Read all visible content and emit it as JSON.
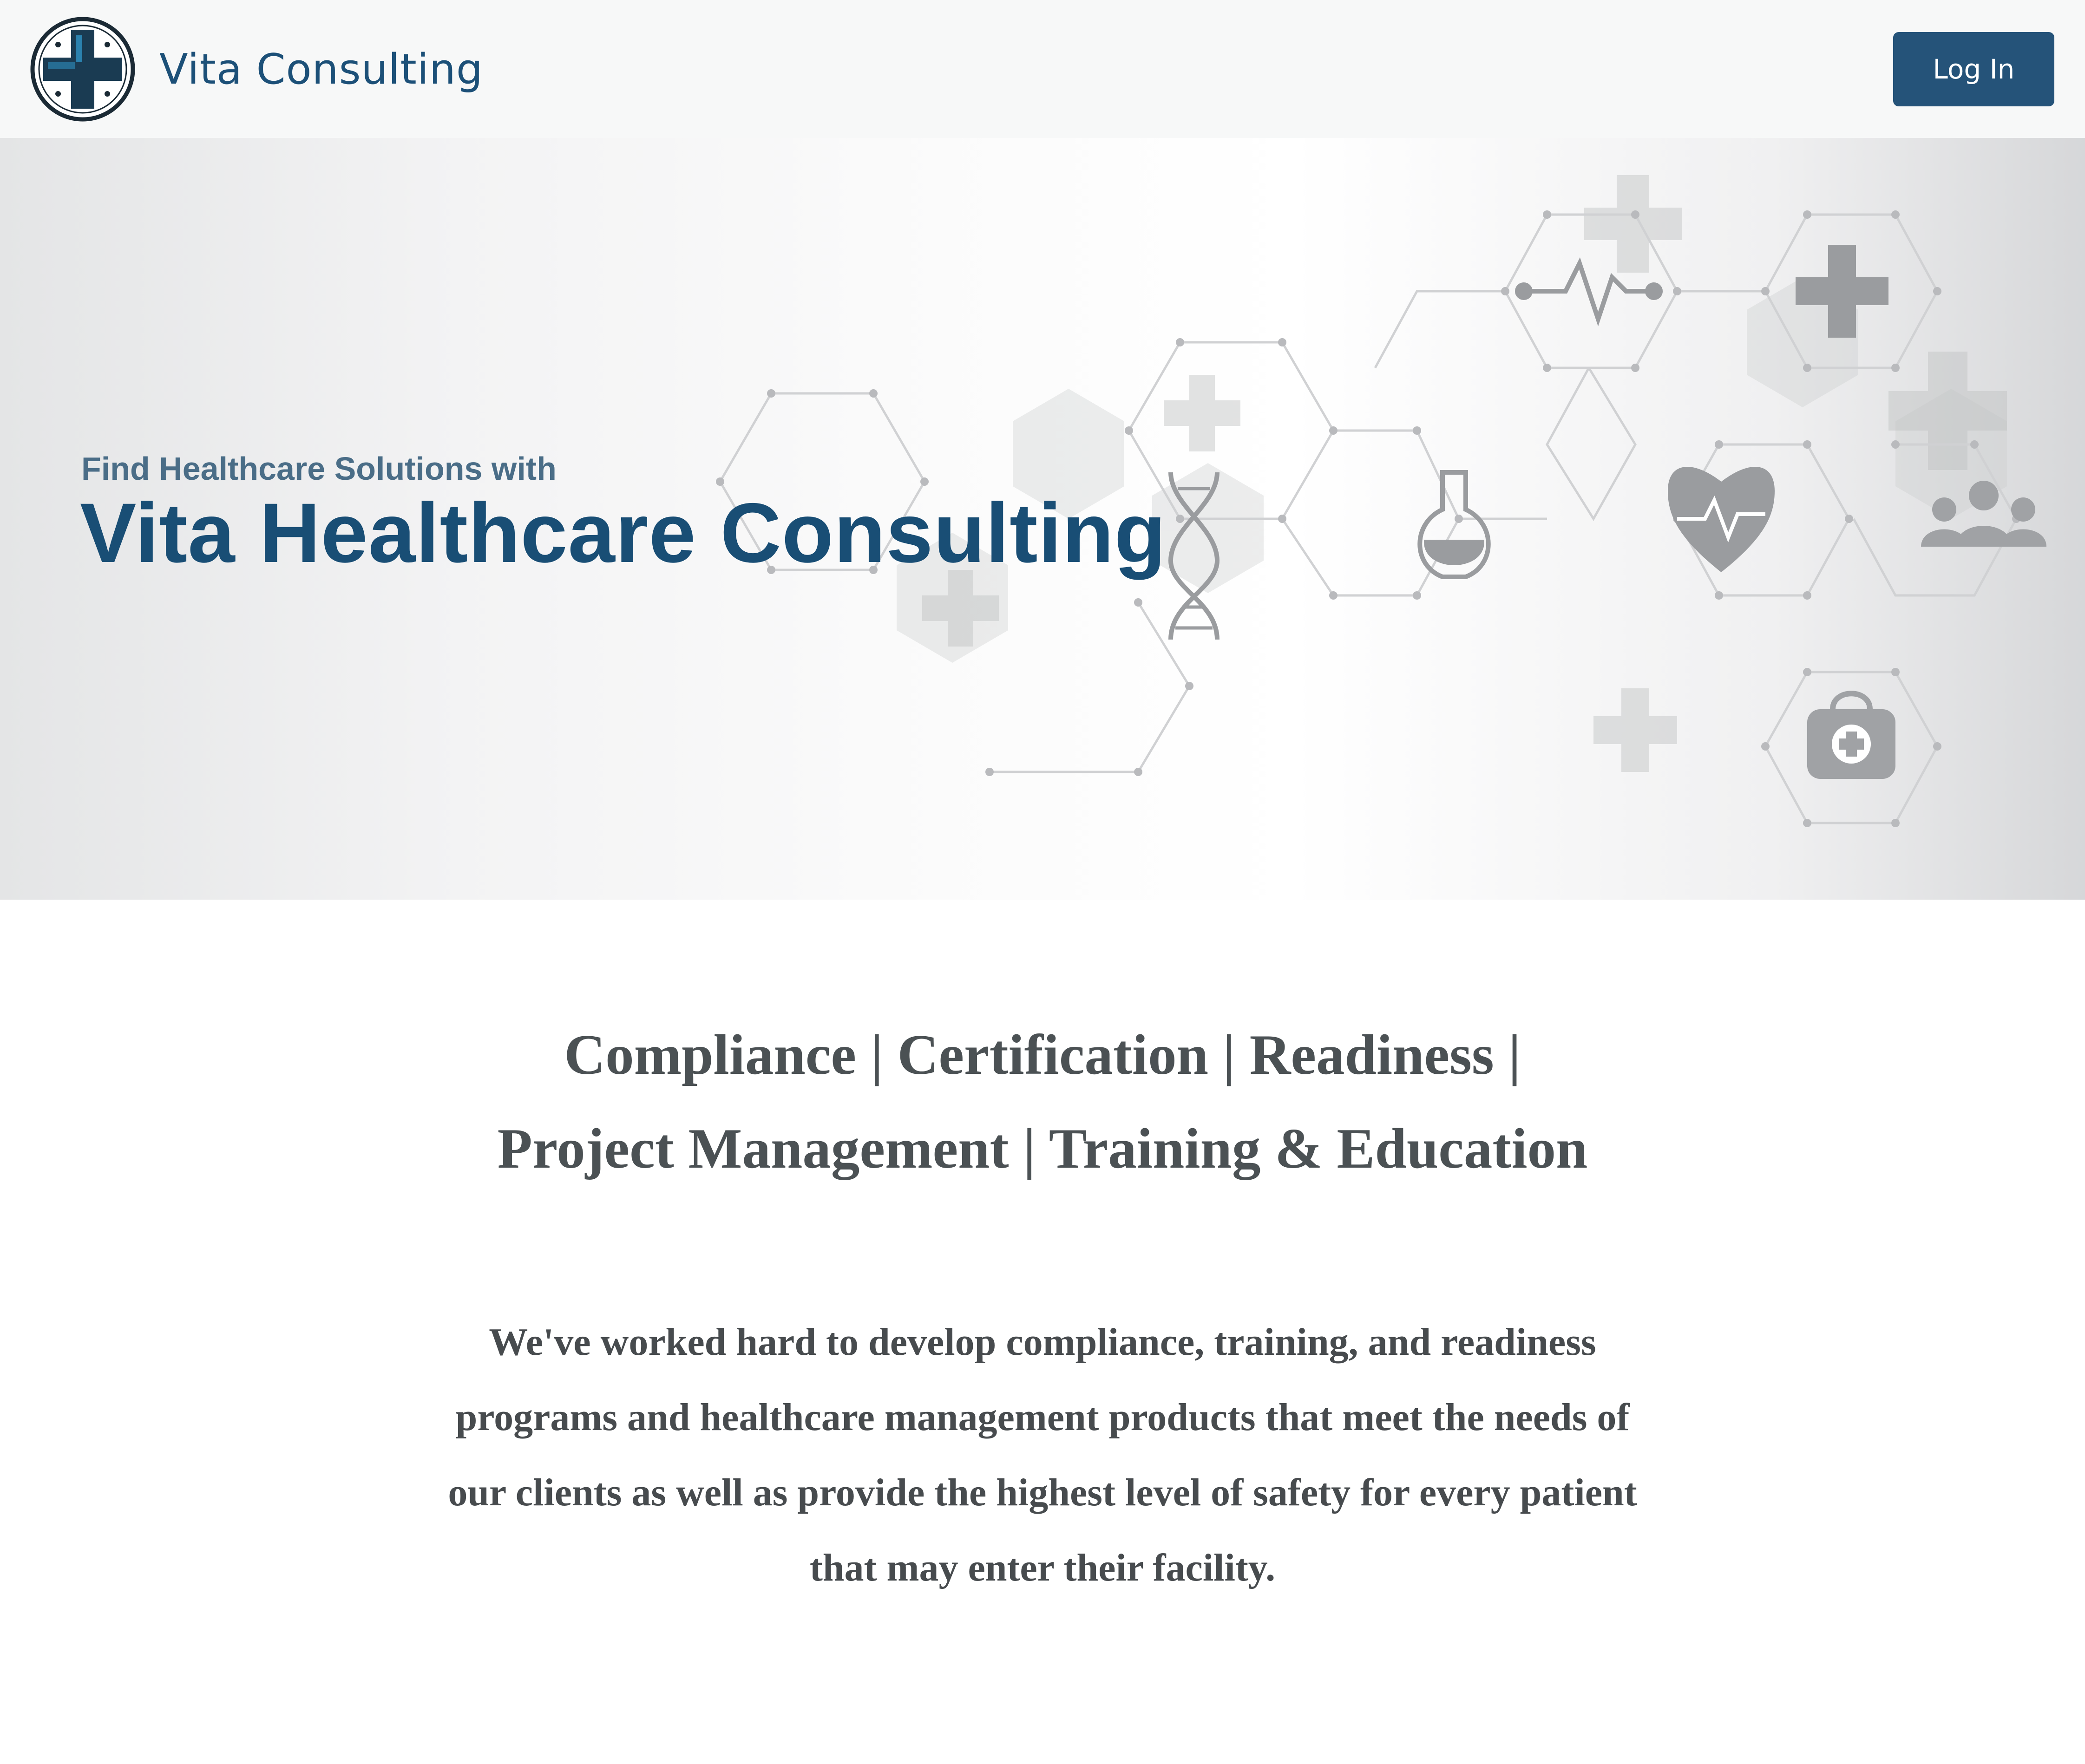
{
  "header": {
    "brand_name": "Vita Consulting",
    "logo_icon": "medical-cross-icon",
    "login_label": "Log In",
    "colors": {
      "brand": "#1c5078",
      "button": "#255379",
      "background": "#f7f8f8"
    }
  },
  "hero": {
    "tagline": "Find Healthcare Solutions with",
    "title": "Vita Healthcare Consulting",
    "icons": [
      "dna-icon",
      "heartbeat-line-icon",
      "cross-icon",
      "flask-icon",
      "heart-pulse-icon",
      "medical-team-icon",
      "first-aid-kit-icon"
    ],
    "colors": {
      "title": "#194e75",
      "tagline": "#4a6d87",
      "icon": "#9a9c9f"
    }
  },
  "services": {
    "line1": "Compliance | Certification | Readiness |",
    "line2": "Project Management | Training & Education"
  },
  "intro": {
    "text": "We've worked hard to develop compliance, training, and readiness programs and healthcare management products that meet the needs of our clients as well as provide the highest level of safety for every patient that may enter their facility."
  }
}
